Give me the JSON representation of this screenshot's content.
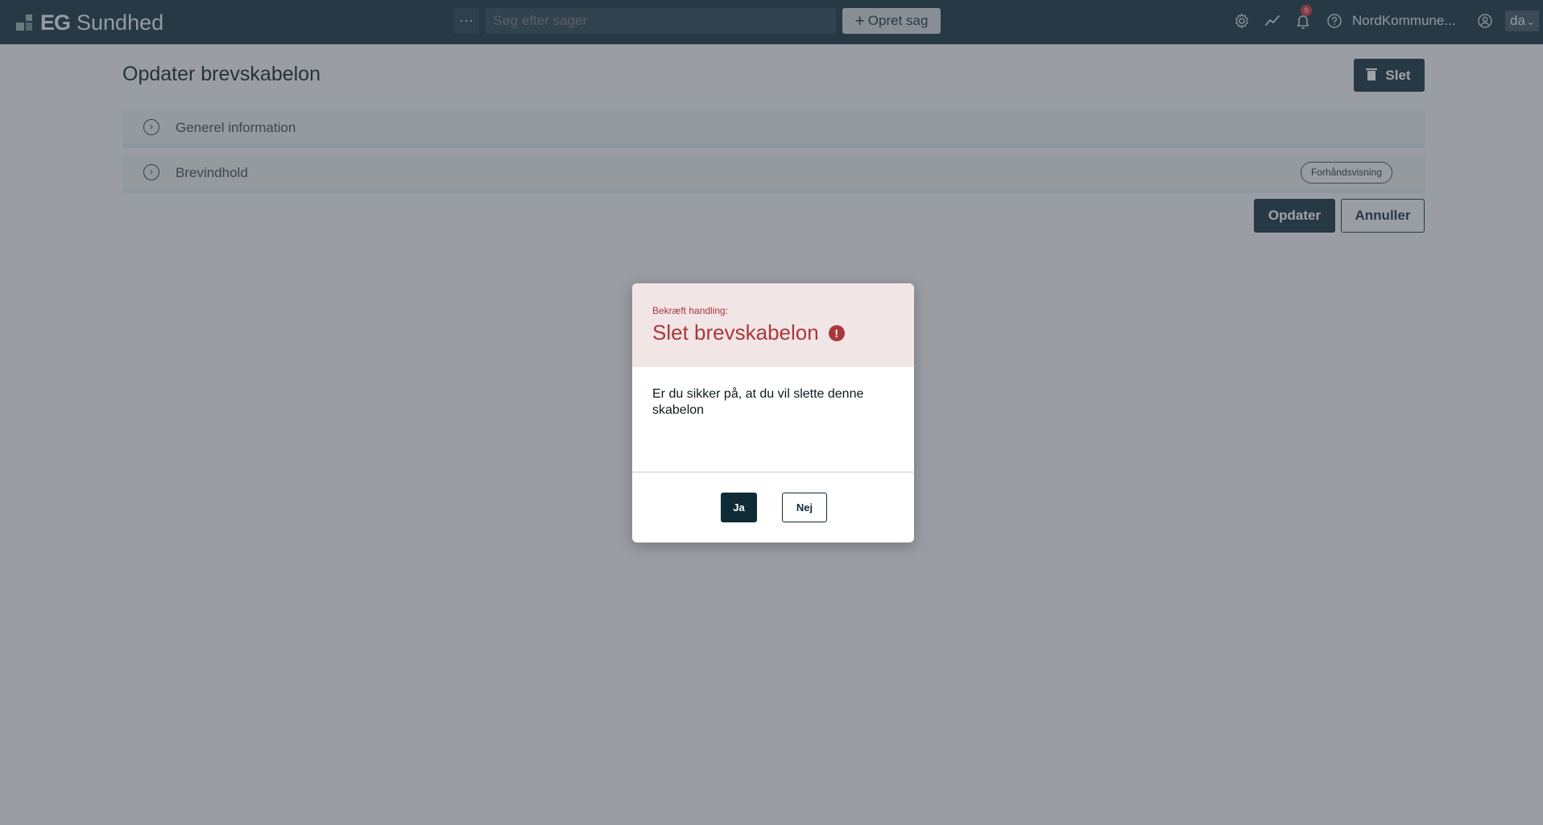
{
  "brand": {
    "short": "EG",
    "name": "Sundhed"
  },
  "header": {
    "more_label": "···",
    "search_placeholder": "Søg efter sager",
    "create_label": "Opret sag",
    "notification_count": "9",
    "tenant_name": "NordKommune...",
    "language": "da",
    "icons": [
      "gear-icon",
      "chart-trend-icon",
      "bell-icon",
      "help-icon",
      "user-icon"
    ]
  },
  "page": {
    "title": "Opdater brevskabelon",
    "delete_label": "Slet",
    "panels": [
      {
        "label": "Generel information"
      },
      {
        "label": "Brevindhold",
        "action_label": "Forhåndsvisning"
      }
    ],
    "update_label": "Opdater",
    "cancel_label": "Annuller"
  },
  "modal": {
    "kicker": "Bekræft handling:",
    "title": "Slet brevskabelon",
    "body": "Er du sikker på, at du vil slette denne skabelon",
    "yes_label": "Ja",
    "no_label": "Nej"
  },
  "colors": {
    "primary": "#0f2b37",
    "danger": "#a9383d",
    "danger_bg": "#f1e5e5",
    "badge": "#d22e3b"
  }
}
